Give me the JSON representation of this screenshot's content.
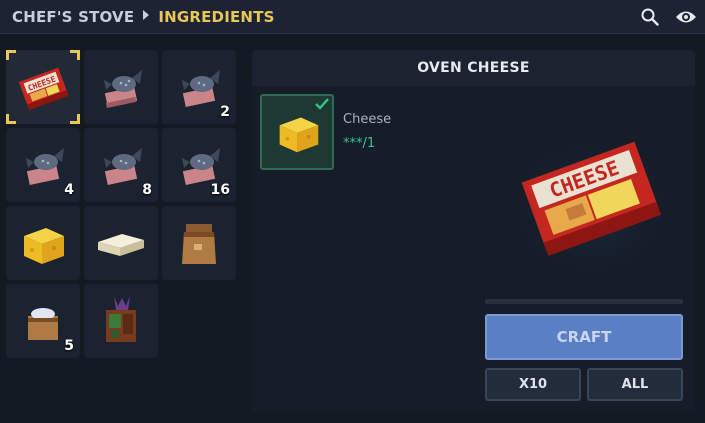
{
  "header": {
    "breadcrumb_root": "CHEF'S STOVE",
    "breadcrumb_current": "INGREDIENTS",
    "icons": [
      "search-icon",
      "eye-icon"
    ]
  },
  "inventory": {
    "slots": [
      {
        "item": "cheese-box",
        "qty": "",
        "selected": true
      },
      {
        "item": "fish",
        "qty": ""
      },
      {
        "item": "fish",
        "qty": "2"
      },
      {
        "item": "fish",
        "qty": "4"
      },
      {
        "item": "fish",
        "qty": "8"
      },
      {
        "item": "fish",
        "qty": "16"
      },
      {
        "item": "cheese-wedge",
        "qty": ""
      },
      {
        "item": "butter",
        "qty": ""
      },
      {
        "item": "flour-sack",
        "qty": ""
      },
      {
        "item": "salt-sack",
        "qty": "5"
      },
      {
        "item": "herb-crate",
        "qty": ""
      }
    ]
  },
  "recipe": {
    "title": "OVEN CHEESE",
    "ingredients": [
      {
        "name": "Cheese",
        "count": "***/1",
        "fulfilled": true,
        "icon": "cheese-wedge"
      }
    ],
    "result_icon": "cheese-box"
  },
  "actions": {
    "craft_label": "CRAFT",
    "x10_label": "X10",
    "all_label": "ALL",
    "progress": 0
  },
  "colors": {
    "accent_gold": "#e9c65b",
    "craft_blue": "#5b7fc3",
    "success_green": "#38c38a"
  }
}
